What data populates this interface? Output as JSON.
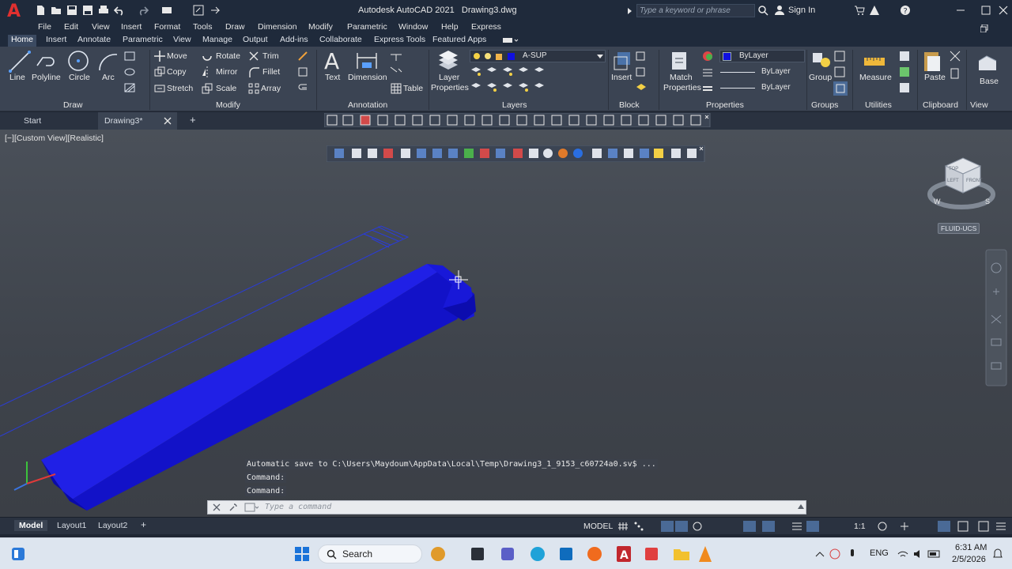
{
  "app": {
    "title": "Autodesk AutoCAD 2021",
    "document": "Drawing3.dwg",
    "logo": "A",
    "search_placeholder": "Type a keyword or phrase",
    "sign_in": "Sign In"
  },
  "menubar": [
    "File",
    "Edit",
    "View",
    "Insert",
    "Format",
    "Tools",
    "Draw",
    "Dimension",
    "Modify",
    "Parametric",
    "Window",
    "Help",
    "Express"
  ],
  "ribbon_tabs": [
    "Home",
    "Insert",
    "Annotate",
    "Parametric",
    "View",
    "Manage",
    "Output",
    "Add-ins",
    "Collaborate",
    "Express Tools",
    "Featured Apps"
  ],
  "ribbon": {
    "draw": {
      "title": "Draw",
      "line": "Line",
      "polyline": "Polyline",
      "circle": "Circle",
      "arc": "Arc"
    },
    "modify": {
      "title": "Modify",
      "move": "Move",
      "rotate": "Rotate",
      "trim": "Trim",
      "copy": "Copy",
      "mirror": "Mirror",
      "fillet": "Fillet",
      "stretch": "Stretch",
      "scale": "Scale",
      "array": "Array"
    },
    "annotation": {
      "title": "Annotation",
      "text": "Text",
      "dimension": "Dimension",
      "table": "Table"
    },
    "layers": {
      "title": "Layers",
      "layer_properties_1": "Layer",
      "layer_properties_2": "Properties",
      "current_layer": "A-SUP"
    },
    "block": {
      "title": "Block",
      "insert": "Insert"
    },
    "properties": {
      "title": "Properties",
      "match_1": "Match",
      "match_2": "Properties",
      "color": "ByLayer",
      "linetype": "ByLayer",
      "lineweight": "ByLayer"
    },
    "groups": {
      "title": "Groups",
      "group": "Group"
    },
    "utilities": {
      "title": "Utilities",
      "measure": "Measure"
    },
    "clipboard": {
      "title": "Clipboard",
      "paste": "Paste"
    },
    "view": {
      "title": "View",
      "base": "Base"
    }
  },
  "file_tabs": {
    "start": "Start",
    "drawing": "Drawing3*",
    "add": "+"
  },
  "viewport": {
    "label": "[−][Custom View][Realistic]",
    "ucs": "FLUID-UCS",
    "viewcube_face_top": "TOP",
    "viewcube_face_front": "FRONT",
    "viewcube_face_left": "LEFT",
    "compass_w": "W",
    "compass_s": "S"
  },
  "command": {
    "history": [
      "Automatic save to C:\\Users\\Maydoum\\AppData\\Local\\Temp\\Drawing3_1_9153_c60724a0.sv$ ...",
      "Command:",
      "Command:"
    ],
    "placeholder": "Type a command"
  },
  "status": {
    "tabs": [
      "Model",
      "Layout1",
      "Layout2"
    ],
    "add_tab": "+",
    "space": "MODEL",
    "scale": "1:1"
  },
  "taskbar": {
    "search": "Search",
    "lang": "ENG",
    "time": "6:31 AM",
    "date": "2/5/2026"
  },
  "colors": {
    "solid_blue": "#1010c8",
    "wire_blue": "#2a3cd8",
    "logo_red": "#e0302f"
  }
}
